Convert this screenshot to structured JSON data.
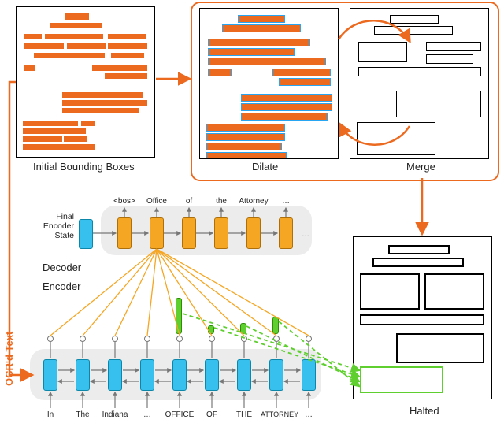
{
  "labels": {
    "initial": "Initial Bounding Boxes",
    "dilate": "Dilate",
    "merge": "Merge",
    "halted": "Halted",
    "decoder": "Decoder",
    "encoder": "Encoder",
    "final_encoder_state_l1": "Final",
    "final_encoder_state_l2": "Encoder",
    "final_encoder_state_l3": "State",
    "ocr": "OCR'd Text",
    "ellipsis": "…"
  },
  "decoder_tokens": [
    "<bos>",
    "Office",
    "of",
    "the",
    "Attorney",
    "…"
  ],
  "encoder_tokens": [
    "In",
    "The",
    "Indiana",
    "…",
    "OFFICE",
    "OF",
    "THE",
    "ATTORNEY",
    "…"
  ]
}
